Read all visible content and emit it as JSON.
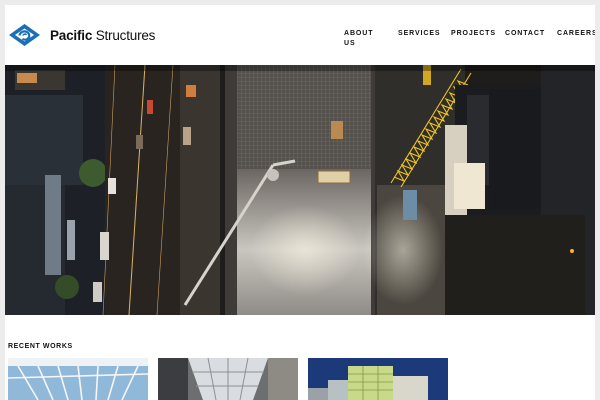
{
  "header": {
    "brand": {
      "bold": "Pacific",
      "regular": "Structures",
      "logo_icon": "pacific-structures-diamond-logo"
    },
    "nav": [
      {
        "label": "ABOUT US"
      },
      {
        "label": "SERVICES"
      },
      {
        "label": "PROJECTS"
      },
      {
        "label": "CONTACT"
      },
      {
        "label": "CAREERS"
      }
    ]
  },
  "hero": {
    "image": "night aerial view of construction site with yellow tower crane and city street"
  },
  "recent_works": {
    "title": "RECENT WORKS",
    "items": [
      {
        "image": "white steel lattice canopy against blue sky"
      },
      {
        "image": "atrium skylight interior"
      },
      {
        "image": "glass building at dusk"
      }
    ]
  },
  "colors": {
    "brand_blue": "#1a6fb5",
    "background": "#ececec",
    "text": "#111111"
  }
}
